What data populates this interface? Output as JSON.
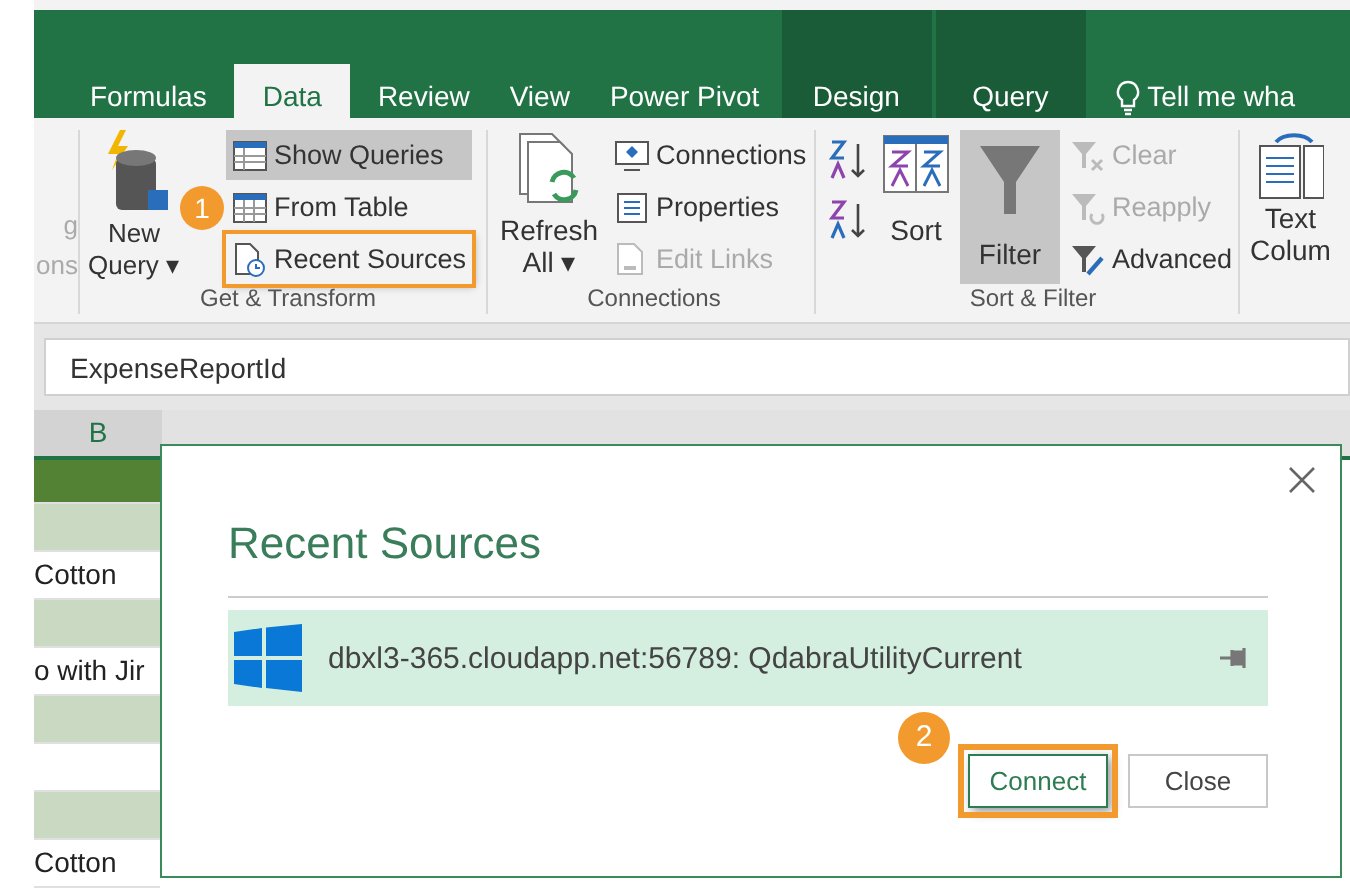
{
  "tabs": [
    {
      "label": "Formulas",
      "selected": false,
      "kind": "normal"
    },
    {
      "label": "Data",
      "selected": true,
      "kind": "normal"
    },
    {
      "label": "Review",
      "selected": false,
      "kind": "normal"
    },
    {
      "label": "View",
      "selected": false,
      "kind": "normal"
    },
    {
      "label": "Power Pivot",
      "selected": false,
      "kind": "normal"
    },
    {
      "label": "Design",
      "selected": false,
      "kind": "contextual"
    },
    {
      "label": "Query",
      "selected": false,
      "kind": "contextual"
    }
  ],
  "tell_me": "Tell me wha",
  "ribbon": {
    "cut_group": [
      "g",
      "ons"
    ],
    "get_transform": {
      "label": "Get & Transform",
      "new_query": [
        "New",
        "Query ▾"
      ],
      "commands": [
        {
          "label": "Show Queries",
          "selected": true,
          "annotated": false
        },
        {
          "label": "From Table",
          "selected": false,
          "annotated": false
        },
        {
          "label": "Recent Sources",
          "selected": false,
          "annotated": true
        }
      ]
    },
    "connections": {
      "label": "Connections",
      "refresh": [
        "Refresh",
        "All ▾"
      ],
      "commands": [
        {
          "label": "Connections",
          "disabled": false
        },
        {
          "label": "Properties",
          "disabled": false
        },
        {
          "label": "Edit Links",
          "disabled": true
        }
      ]
    },
    "sort_filter": {
      "label": "Sort & Filter",
      "sort": "Sort",
      "filter": {
        "label": "Filter",
        "selected": true
      },
      "commands": [
        {
          "label": "Clear",
          "disabled": true
        },
        {
          "label": "Reapply",
          "disabled": true
        },
        {
          "label": "Advanced",
          "disabled": false
        }
      ]
    },
    "text_columns": [
      "Text",
      "Colum"
    ]
  },
  "formula_bar": {
    "value": "ExpenseReportId"
  },
  "sheet": {
    "column": "B",
    "rows": [
      {
        "text": "",
        "kind": "header"
      },
      {
        "text": "",
        "kind": "band"
      },
      {
        "text": "Cotton",
        "kind": "plain"
      },
      {
        "text": "",
        "kind": "band"
      },
      {
        "text": "o with Jir",
        "kind": "plain"
      },
      {
        "text": "",
        "kind": "band"
      },
      {
        "text": "",
        "kind": "plain"
      },
      {
        "text": "",
        "kind": "band"
      },
      {
        "text": "Cotton",
        "kind": "plain"
      }
    ]
  },
  "dialog": {
    "title": "Recent Sources",
    "sources": [
      {
        "name": "dbxl3-365.cloudapp.net:56789: QdabraUtilityCurrent"
      }
    ],
    "buttons": [
      {
        "label": "Connect",
        "default": true,
        "annotated": true
      },
      {
        "label": "Close",
        "default": false,
        "annotated": false
      }
    ]
  },
  "callouts": [
    "1",
    "2"
  ]
}
